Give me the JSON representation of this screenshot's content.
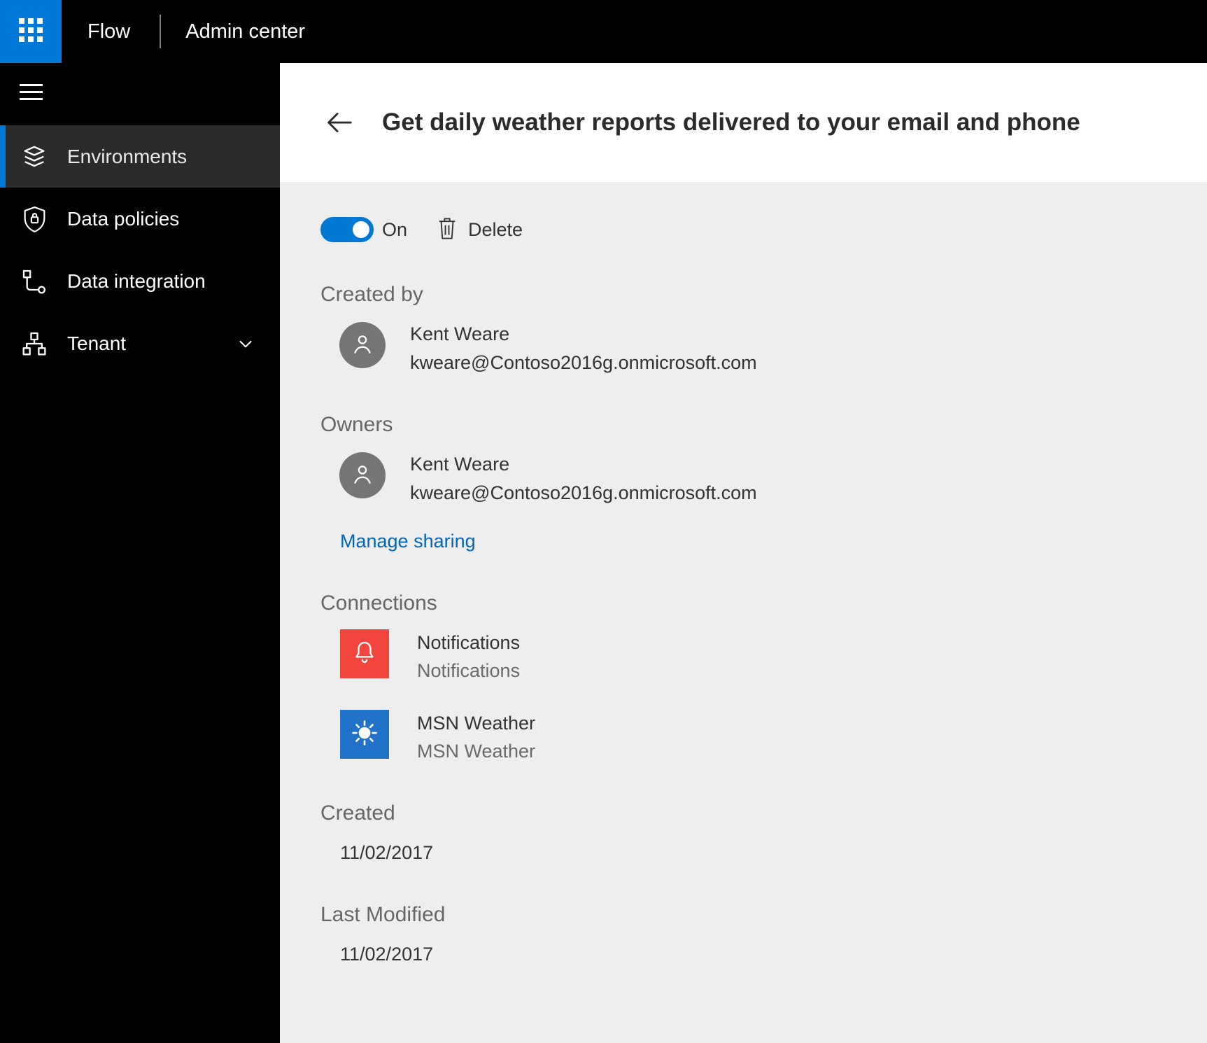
{
  "topbar": {
    "app_name": "Flow",
    "section_label": "Admin center",
    "waffle_icon": "app-launcher-icon"
  },
  "sidebar": {
    "menu_icon": "hamburger-icon",
    "items": [
      {
        "label": "Environments",
        "icon": "layers-icon",
        "selected": true
      },
      {
        "label": "Data policies",
        "icon": "shield-lock-icon",
        "selected": false
      },
      {
        "label": "Data integration",
        "icon": "integration-icon",
        "selected": false
      },
      {
        "label": "Tenant",
        "icon": "org-chart-icon",
        "selected": false,
        "expand_icon": "chevron-down-icon"
      }
    ]
  },
  "header": {
    "back_icon": "back-arrow-icon",
    "title": "Get daily weather reports delivered to your email and phone"
  },
  "main": {
    "toggle": {
      "state": "on",
      "label": "On"
    },
    "delete": {
      "label": "Delete",
      "icon": "trash-icon"
    },
    "created_by": {
      "heading": "Created by",
      "name": "Kent Weare",
      "email": "kweare@Contoso2016g.onmicrosoft.com",
      "avatar_icon": "person-icon"
    },
    "owners": {
      "heading": "Owners",
      "name": "Kent Weare",
      "email": "kweare@Contoso2016g.onmicrosoft.com",
      "avatar_icon": "person-icon",
      "manage_sharing_label": "Manage sharing"
    },
    "connections": {
      "heading": "Connections",
      "items": [
        {
          "name": "Notifications",
          "type": "Notifications",
          "icon": "bell-icon",
          "tile_color": "#f2453d"
        },
        {
          "name": "MSN Weather",
          "type": "MSN Weather",
          "icon": "sun-icon",
          "tile_color": "#2173c9"
        }
      ]
    },
    "created": {
      "heading": "Created",
      "value": "11/02/2017"
    },
    "last_modified": {
      "heading": "Last Modified",
      "value": "11/02/2017"
    }
  },
  "colors": {
    "accent": "#0078d7",
    "toggle_on": "#0078d4",
    "link": "#0067b8",
    "content_background": "#eeeeee",
    "sidebar_background": "#000000",
    "selected_item_background": "#2b2b2b"
  }
}
